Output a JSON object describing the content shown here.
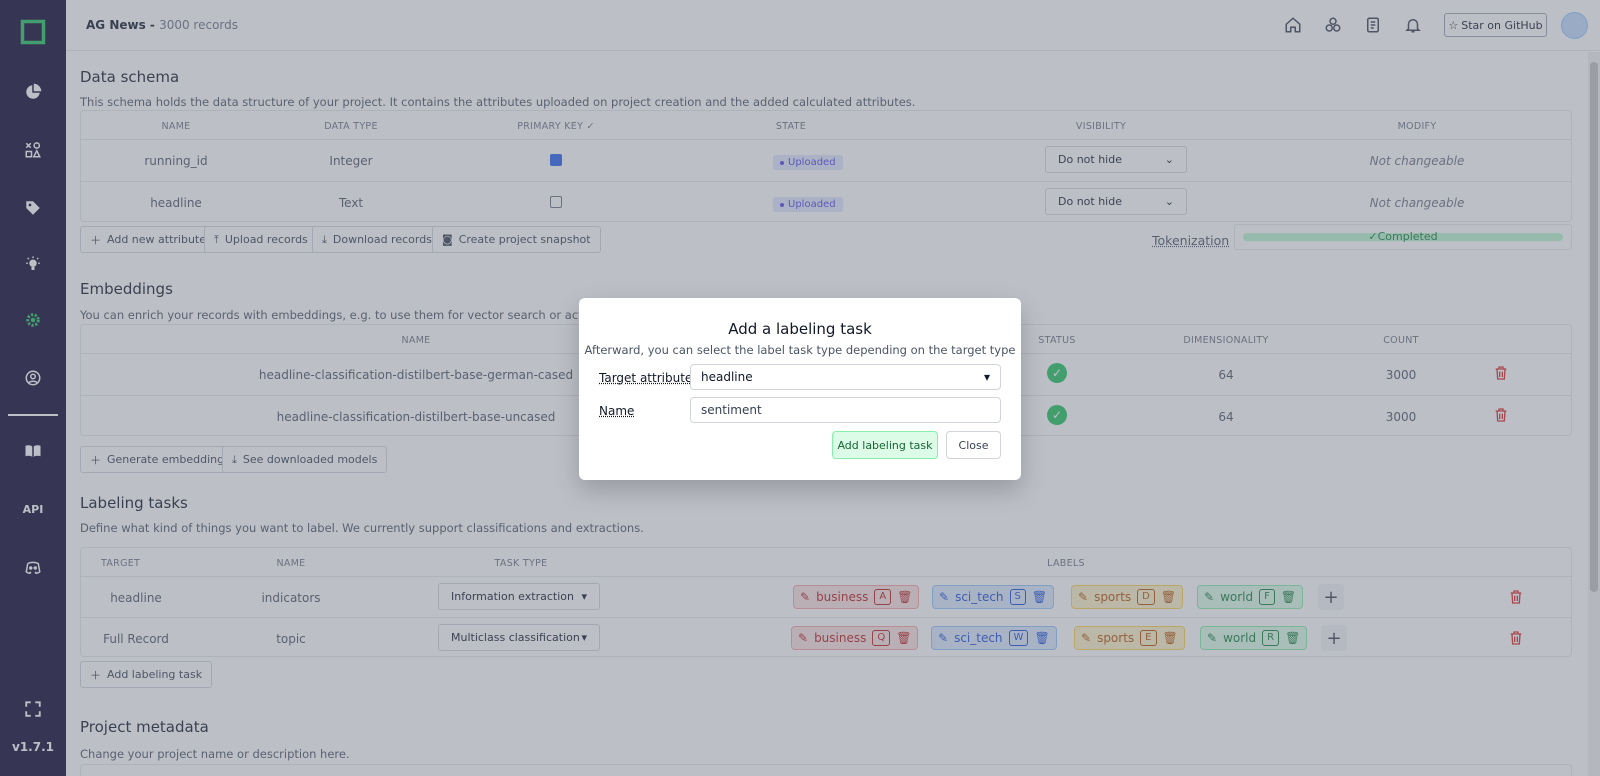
{
  "app": {
    "version": "v1.7.1",
    "api_label": "API"
  },
  "topbar": {
    "project_name": "AG News",
    "separator": " - ",
    "record_count": "3000 records",
    "github_label": "Star on GitHub"
  },
  "schema": {
    "title": "Data schema",
    "description": "This schema holds the data structure of your project. It contains the attributes uploaded on project creation and the added calculated attributes.",
    "columns": [
      "Name",
      "Data type",
      "Primary key ✓",
      "State",
      "Visibility",
      "Modify"
    ],
    "rows": [
      {
        "name": "running_id",
        "type": "Integer",
        "primary": true,
        "state": "Uploaded",
        "visibility": "Do not hide",
        "modify": "Not changeable"
      },
      {
        "name": "headline",
        "type": "Text",
        "primary": false,
        "state": "Uploaded",
        "visibility": "Do not hide",
        "modify": "Not changeable"
      }
    ],
    "buttons": {
      "add_attribute": "Add new attribute",
      "upload": "Upload records",
      "download": "Download records",
      "snapshot": "Create project snapshot"
    },
    "tokenization_label": "Tokenization",
    "tokenization_status": "✓Completed"
  },
  "embeddings": {
    "title": "Embeddings",
    "description": "You can enrich your records with embeddings, e.g. to use them for vector search or active tra",
    "columns": [
      "Name",
      "Status",
      "Dimensionality",
      "Count"
    ],
    "rows": [
      {
        "name": "headline-classification-distilbert-base-german-cased",
        "dim": "64",
        "count": "3000"
      },
      {
        "name": "headline-classification-distilbert-base-uncased",
        "dim": "64",
        "count": "3000"
      }
    ],
    "buttons": {
      "generate": "Generate embedding",
      "models": "See downloaded models"
    }
  },
  "labeling": {
    "title": "Labeling tasks",
    "description": "Define what kind of things you want to label. We currently support classifications and extractions.",
    "columns": [
      "Target",
      "Name",
      "Task type",
      "Labels"
    ],
    "rows": [
      {
        "target": "headline",
        "name": "indicators",
        "task_type": "Information extraction",
        "labels": [
          {
            "name": "business",
            "key": "A"
          },
          {
            "name": "sci_tech",
            "key": "S"
          },
          {
            "name": "sports",
            "key": "D"
          },
          {
            "name": "world",
            "key": "F"
          }
        ]
      },
      {
        "target": "Full Record",
        "name": "topic",
        "task_type": "Multiclass classification",
        "labels": [
          {
            "name": "business",
            "key": "Q"
          },
          {
            "name": "sci_tech",
            "key": "W"
          },
          {
            "name": "sports",
            "key": "E"
          },
          {
            "name": "world",
            "key": "R"
          }
        ]
      }
    ],
    "add_button": "Add labeling task"
  },
  "metadata": {
    "title": "Project metadata",
    "description": "Change your project name or description here."
  },
  "modal": {
    "title": "Add a labeling task",
    "subtitle": "Afterward, you can select the label task type depending on the target type",
    "target_label": "Target attribute",
    "target_value": "headline",
    "name_label": "Name",
    "name_value": "sentiment",
    "add_button": "Add labeling task",
    "close_button": "Close"
  },
  "colors": {
    "sidebar": "#0c052e",
    "accent_green": "#22c55e",
    "danger": "#dc2626"
  }
}
